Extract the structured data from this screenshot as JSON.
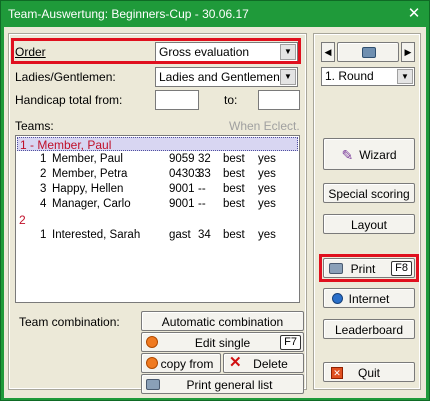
{
  "window": {
    "title": "Team-Auswertung: Beginners-Cup - 30.06.17",
    "close_glyph": "✕"
  },
  "form": {
    "order_label": "Order",
    "order_value": "Gross evaluation",
    "ladies_label": "Ladies/Gentlemen:",
    "ladies_value": "Ladies and Gentlemen",
    "handicap_label": "Handicap total from:",
    "handicap_from_value": "",
    "handicap_to_label": "to:",
    "handicap_to_value": "",
    "teams_label": "Teams:",
    "when_eclect_label": "When Eclect."
  },
  "teams": [
    {
      "header": "1 - Member, Paul",
      "selected": true,
      "rows": [
        {
          "num": "1",
          "name": "Member, Paul",
          "id": "9059",
          "score": "32",
          "type": "best",
          "flag": "yes"
        },
        {
          "num": "2",
          "name": "Member, Petra",
          "id": "04303",
          "score": "33",
          "type": "best",
          "flag": "yes"
        },
        {
          "num": "3",
          "name": "Happy, Hellen",
          "id": "9001",
          "score": "--",
          "type": "best",
          "flag": "yes"
        },
        {
          "num": "4",
          "name": "Manager, Carlo",
          "id": "9001",
          "score": "--",
          "type": "best",
          "flag": "yes"
        }
      ]
    },
    {
      "header": "2",
      "selected": false,
      "rows": [
        {
          "num": "1",
          "name": "Interested, Sarah",
          "id": "gast",
          "score": "34",
          "type": "best",
          "flag": "yes"
        }
      ]
    }
  ],
  "bottom": {
    "team_combination_label": "Team combination:",
    "automatic_combination": "Automatic combination",
    "edit_single": "Edit single",
    "edit_single_key": "F7",
    "copy_from": "copy from",
    "delete": "Delete",
    "print_general_list": "Print general list"
  },
  "right": {
    "prev_glyph": "◀",
    "next_glyph": "▶",
    "round_value": "1. Round",
    "wizard": "Wizard",
    "special_scoring": "Special scoring",
    "layout": "Layout",
    "print": "Print",
    "print_key": "F8",
    "internet": "Internet",
    "leaderboard": "Leaderboard",
    "quit": "Quit"
  },
  "colors": {
    "title_bar": "#1f9a3a",
    "highlight_border": "#e0101e",
    "team_header_text": "#c0102a"
  },
  "icons": [
    "close-icon",
    "dropdown-arrow-icon",
    "printer-icon",
    "wizard-icon",
    "globe-icon",
    "quit-icon",
    "edit-icon",
    "copy-icon",
    "delete-icon"
  ]
}
